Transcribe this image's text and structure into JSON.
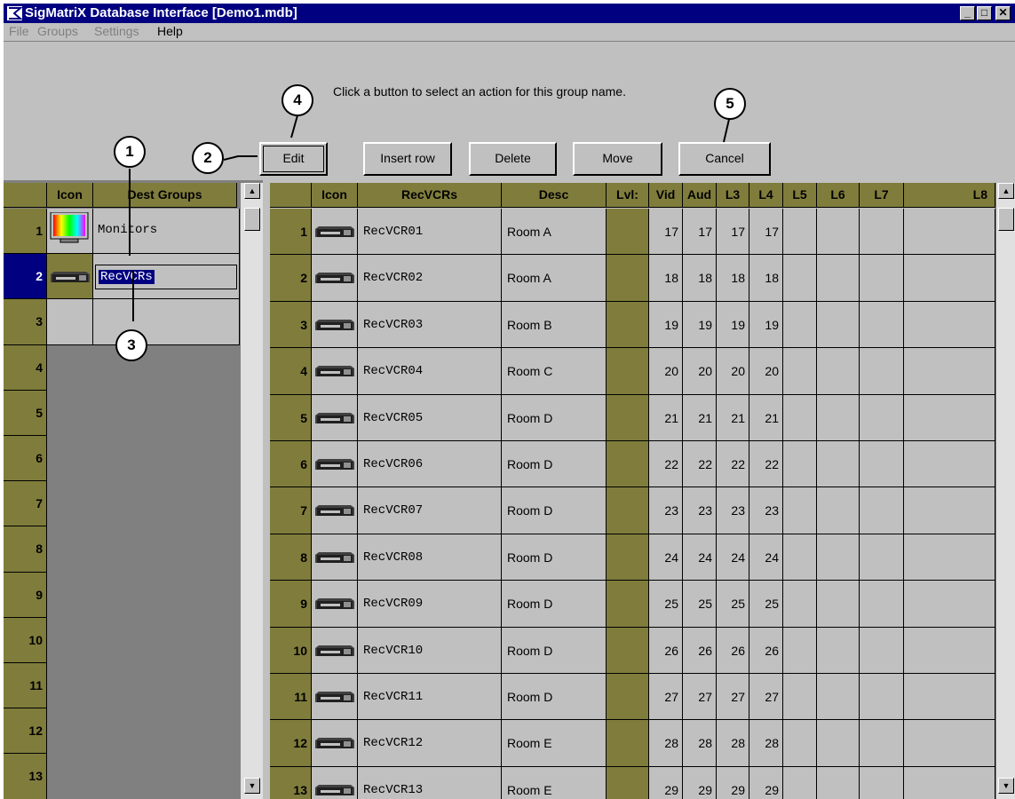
{
  "window": {
    "title": "SigMatriX Database Interface [Demo1.mdb]",
    "min_label": "_",
    "max_label": "□",
    "close_label": "✕"
  },
  "menu": [
    "File",
    "Groups",
    "Settings",
    "Help"
  ],
  "toolbar": {
    "instruction": "Click a button to select an action for this group name.",
    "buttons": [
      "Edit",
      "Insert row",
      "Delete",
      "Move",
      "Cancel"
    ]
  },
  "callouts": [
    "1",
    "2",
    "3",
    "4",
    "5"
  ],
  "left_table": {
    "headers": [
      "Icon",
      "Dest Groups"
    ],
    "rows": [
      {
        "num": "1",
        "icon": "monitor-icon",
        "name": "Monitors"
      },
      {
        "num": "2",
        "icon": "vcr-icon",
        "name": "RecVCRs"
      },
      {
        "num": "3",
        "icon": "",
        "name": ""
      },
      {
        "num": "4"
      },
      {
        "num": "5"
      },
      {
        "num": "6"
      },
      {
        "num": "7"
      },
      {
        "num": "8"
      },
      {
        "num": "9"
      },
      {
        "num": "10"
      },
      {
        "num": "11"
      },
      {
        "num": "12"
      },
      {
        "num": "13"
      }
    ]
  },
  "right_table": {
    "headers": [
      "Icon",
      "RecVCRs",
      "Desc",
      "Lvl:",
      "Vid",
      "Aud",
      "L3",
      "L4",
      "L5",
      "L6",
      "L7",
      "L8"
    ],
    "rows": [
      {
        "num": "1",
        "name": "RecVCR01",
        "desc": "Room A",
        "vid": "17",
        "aud": "17",
        "l3": "17",
        "l4": "17"
      },
      {
        "num": "2",
        "name": "RecVCR02",
        "desc": "Room A",
        "vid": "18",
        "aud": "18",
        "l3": "18",
        "l4": "18"
      },
      {
        "num": "3",
        "name": "RecVCR03",
        "desc": "Room B",
        "vid": "19",
        "aud": "19",
        "l3": "19",
        "l4": "19"
      },
      {
        "num": "4",
        "name": "RecVCR04",
        "desc": "Room C",
        "vid": "20",
        "aud": "20",
        "l3": "20",
        "l4": "20"
      },
      {
        "num": "5",
        "name": "RecVCR05",
        "desc": "Room D",
        "vid": "21",
        "aud": "21",
        "l3": "21",
        "l4": "21"
      },
      {
        "num": "6",
        "name": "RecVCR06",
        "desc": "Room D",
        "vid": "22",
        "aud": "22",
        "l3": "22",
        "l4": "22"
      },
      {
        "num": "7",
        "name": "RecVCR07",
        "desc": "Room D",
        "vid": "23",
        "aud": "23",
        "l3": "23",
        "l4": "23"
      },
      {
        "num": "8",
        "name": "RecVCR08",
        "desc": "Room D",
        "vid": "24",
        "aud": "24",
        "l3": "24",
        "l4": "24"
      },
      {
        "num": "9",
        "name": "RecVCR09",
        "desc": "Room D",
        "vid": "25",
        "aud": "25",
        "l3": "25",
        "l4": "25"
      },
      {
        "num": "10",
        "name": "RecVCR10",
        "desc": "Room D",
        "vid": "26",
        "aud": "26",
        "l3": "26",
        "l4": "26"
      },
      {
        "num": "11",
        "name": "RecVCR11",
        "desc": "Room D",
        "vid": "27",
        "aud": "27",
        "l3": "27",
        "l4": "27"
      },
      {
        "num": "12",
        "name": "RecVCR12",
        "desc": "Room E",
        "vid": "28",
        "aud": "28",
        "l3": "28",
        "l4": "28"
      },
      {
        "num": "13",
        "name": "RecVCR13",
        "desc": "Room E",
        "vid": "29",
        "aud": "29",
        "l3": "29",
        "l4": "29"
      }
    ]
  },
  "colors": {
    "header_olive": "#807d3c",
    "titlebar": "#000080",
    "selection": "#000080",
    "face": "#c0c0c0"
  }
}
